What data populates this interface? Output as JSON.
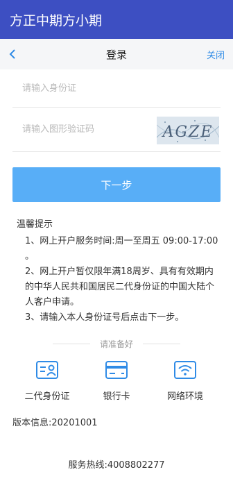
{
  "app": {
    "title": "方正中期方小期"
  },
  "nav": {
    "title": "登录",
    "close_label": "关闭",
    "back_icon": "chevron-left-icon"
  },
  "form": {
    "id_placeholder": "请输入身份证",
    "captcha_placeholder": "请输入图形验证码",
    "captcha_text": "AGZE"
  },
  "next_button": {
    "label": "下一步"
  },
  "tips": {
    "title": "温馨提示",
    "items": [
      "1、网上开户服务时间:周一至周五 09:00-17:00 。",
      "2、网上开户暂仅限年满18周岁、具有有效期内的中华人民共和国居民二代身份证的中国大陆个人客户申请。",
      "3、请输入本人身份证号后点击下一步。"
    ]
  },
  "prepare": {
    "title": "请准备好",
    "items": [
      {
        "label": "二代身份证",
        "icon": "id-card-icon"
      },
      {
        "label": "银行卡",
        "icon": "bank-card-icon"
      },
      {
        "label": "网络环境",
        "icon": "wifi-icon"
      }
    ]
  },
  "version": "版本信息:20201001",
  "hotline": "服务热线:4008802277",
  "colors": {
    "appbar": "#3d4fc2",
    "accent": "#58aef7",
    "link": "#2f8be6"
  }
}
